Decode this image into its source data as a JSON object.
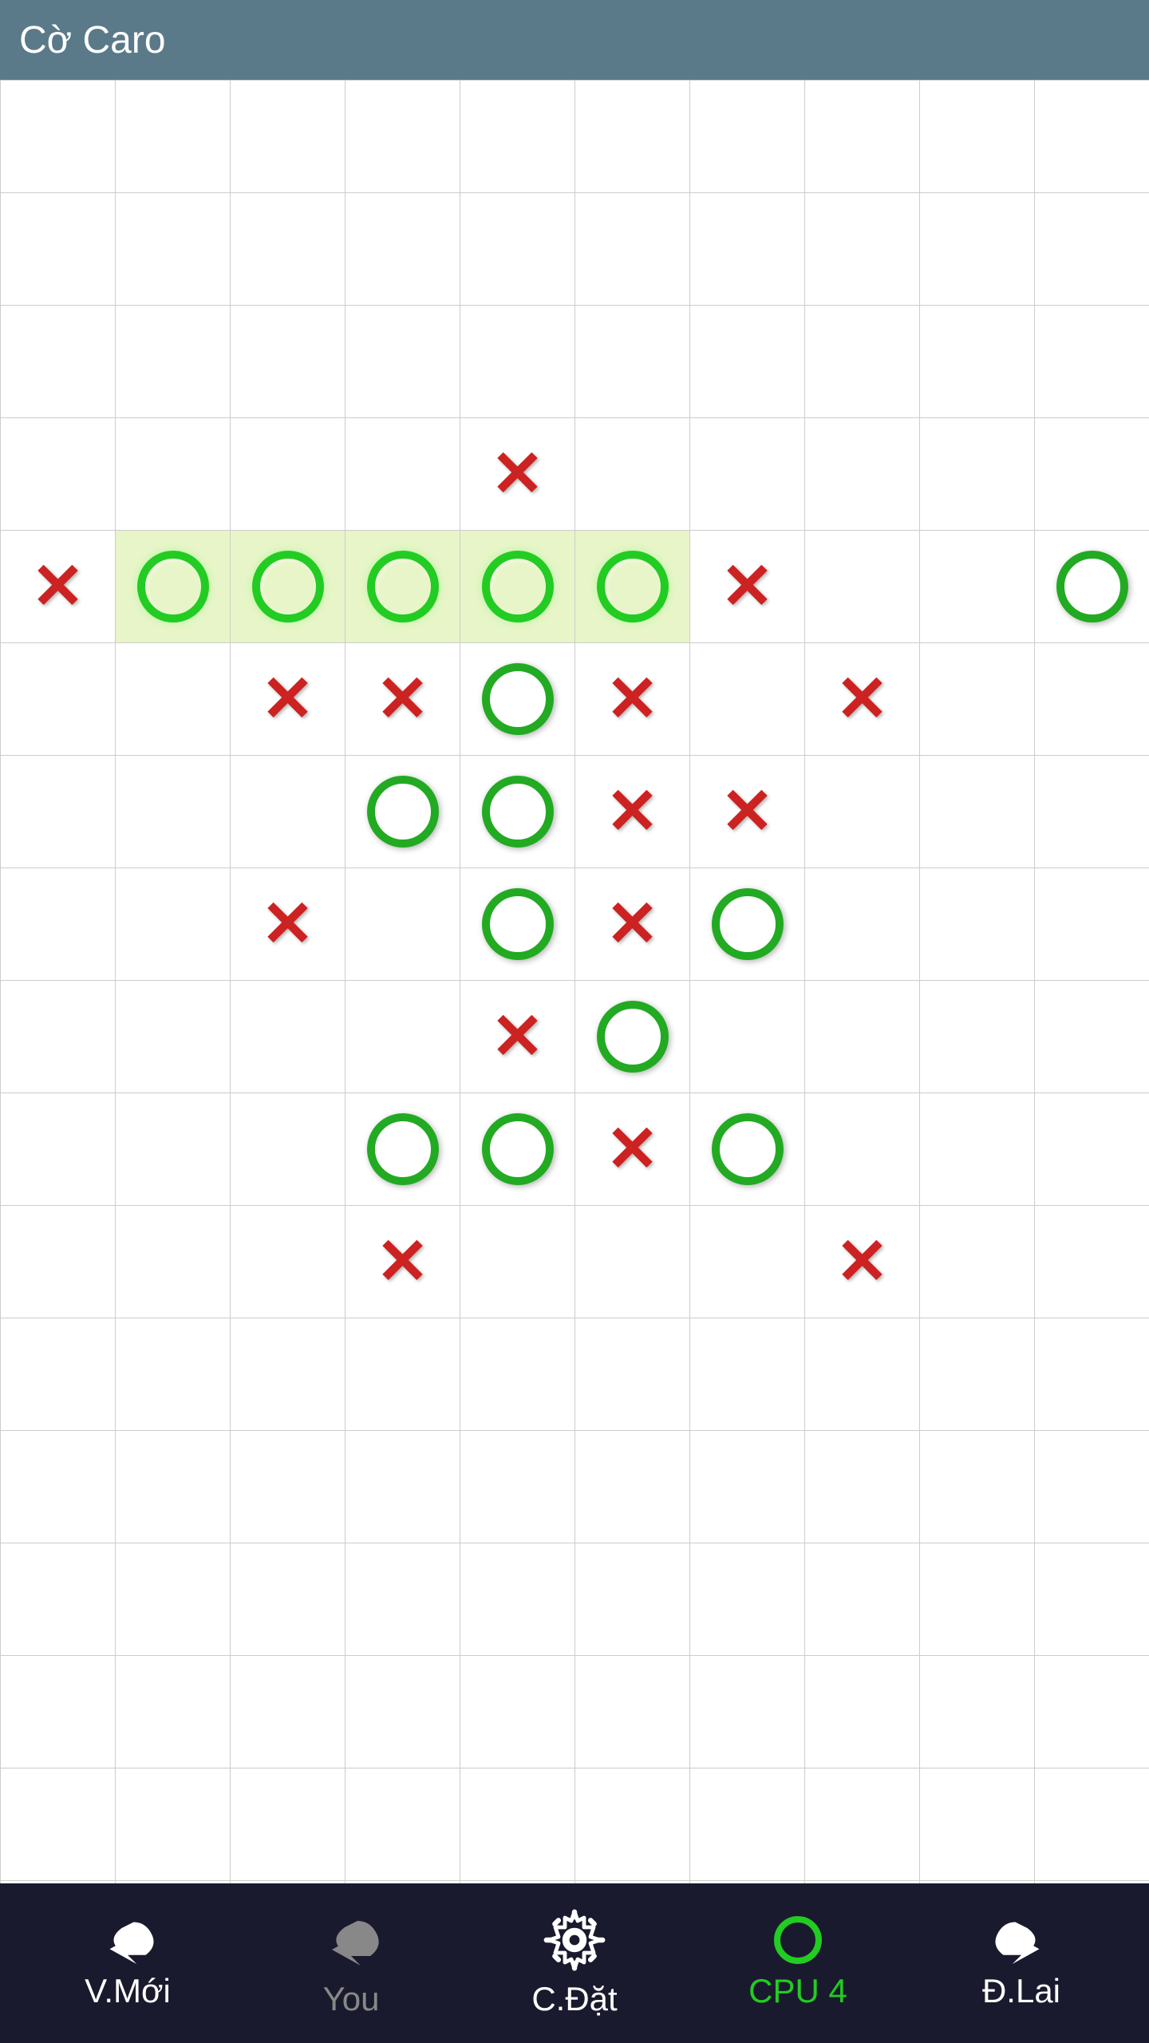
{
  "app": {
    "title": "Cờ Caro"
  },
  "board": {
    "cols": 10,
    "rows": 17,
    "cells": [
      {
        "row": 3,
        "col": 4,
        "piece": "X",
        "highlight": false
      },
      {
        "row": 4,
        "col": 0,
        "piece": "X",
        "highlight": false
      },
      {
        "row": 4,
        "col": 1,
        "piece": "O",
        "highlight": true
      },
      {
        "row": 4,
        "col": 2,
        "piece": "O",
        "highlight": true
      },
      {
        "row": 4,
        "col": 3,
        "piece": "O",
        "highlight": true
      },
      {
        "row": 4,
        "col": 4,
        "piece": "O",
        "highlight": true
      },
      {
        "row": 4,
        "col": 5,
        "piece": "O",
        "highlight": true
      },
      {
        "row": 4,
        "col": 6,
        "piece": "X",
        "highlight": false
      },
      {
        "row": 4,
        "col": 9,
        "piece": "O",
        "highlight": false
      },
      {
        "row": 5,
        "col": 2,
        "piece": "X",
        "highlight": false
      },
      {
        "row": 5,
        "col": 3,
        "piece": "X",
        "highlight": false
      },
      {
        "row": 5,
        "col": 4,
        "piece": "O",
        "highlight": false
      },
      {
        "row": 5,
        "col": 5,
        "piece": "X",
        "highlight": false
      },
      {
        "row": 5,
        "col": 7,
        "piece": "X",
        "highlight": false
      },
      {
        "row": 6,
        "col": 3,
        "piece": "O",
        "highlight": false
      },
      {
        "row": 6,
        "col": 4,
        "piece": "O",
        "highlight": false
      },
      {
        "row": 6,
        "col": 5,
        "piece": "X",
        "highlight": false
      },
      {
        "row": 6,
        "col": 6,
        "piece": "X",
        "highlight": false
      },
      {
        "row": 7,
        "col": 2,
        "piece": "X",
        "highlight": false
      },
      {
        "row": 7,
        "col": 4,
        "piece": "O",
        "highlight": false
      },
      {
        "row": 7,
        "col": 5,
        "piece": "X",
        "highlight": false
      },
      {
        "row": 7,
        "col": 6,
        "piece": "O",
        "highlight": false
      },
      {
        "row": 8,
        "col": 4,
        "piece": "X",
        "highlight": false
      },
      {
        "row": 8,
        "col": 5,
        "piece": "O",
        "highlight": false
      },
      {
        "row": 9,
        "col": 3,
        "piece": "O",
        "highlight": false
      },
      {
        "row": 9,
        "col": 4,
        "piece": "O",
        "highlight": false
      },
      {
        "row": 9,
        "col": 5,
        "piece": "X",
        "highlight": false
      },
      {
        "row": 9,
        "col": 6,
        "piece": "O",
        "highlight": false
      },
      {
        "row": 10,
        "col": 3,
        "piece": "X",
        "highlight": false
      },
      {
        "row": 10,
        "col": 7,
        "piece": "X",
        "highlight": false
      }
    ],
    "highlight_row": 4,
    "highlight_cols": [
      1,
      2,
      3,
      4,
      5
    ]
  },
  "bottomBar": {
    "buttons": [
      {
        "id": "new-game",
        "label": "V.Mới",
        "icon": "undo-left",
        "disabled": false
      },
      {
        "id": "you",
        "label": "You",
        "icon": "you-indicator",
        "disabled": true
      },
      {
        "id": "settings",
        "label": "C.Đặt",
        "icon": "gear",
        "disabled": false
      },
      {
        "id": "cpu",
        "label": "CPU 4",
        "icon": "circle-green",
        "disabled": false
      },
      {
        "id": "undo",
        "label": "Đ.Lai",
        "icon": "undo-right",
        "disabled": false
      }
    ]
  }
}
